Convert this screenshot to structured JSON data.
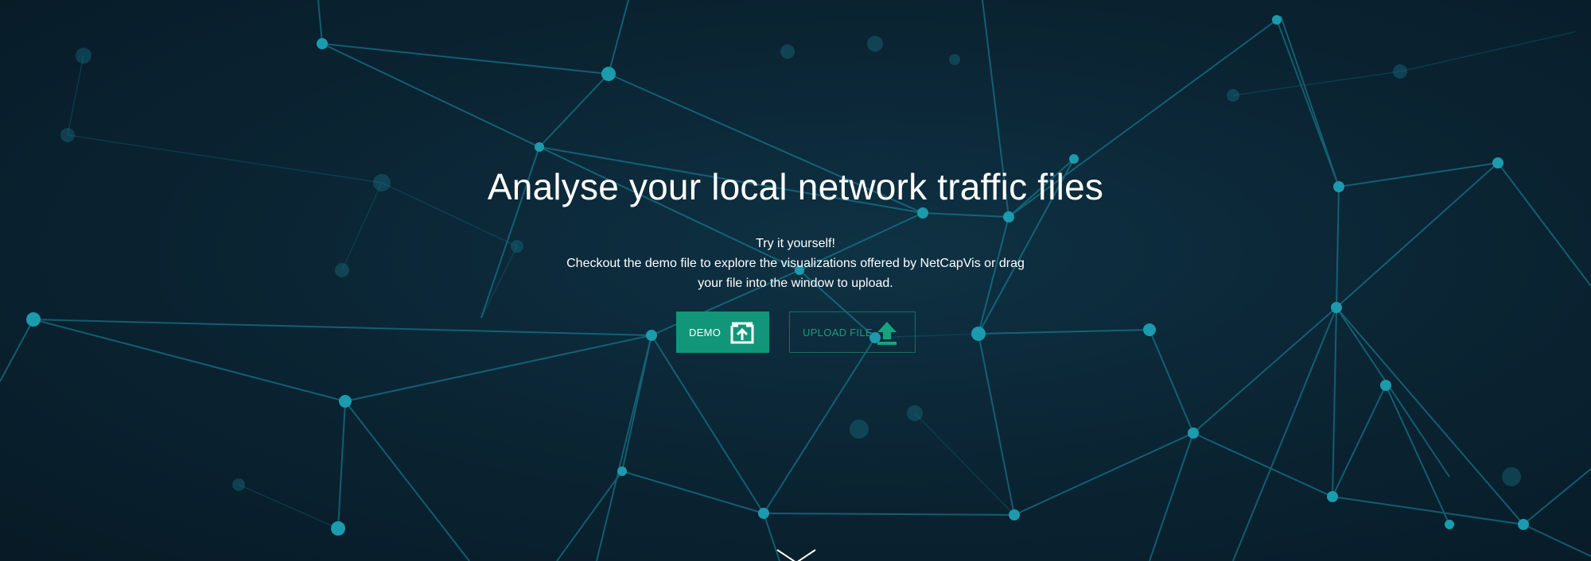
{
  "hero": {
    "title": "Analyse your local network traffic files",
    "subtitle_line1": "Try it yourself!",
    "subtitle_line2": "Checkout the demo file to explore the visualizations offered by NetCapVis or drag",
    "subtitle_line3": "your file into the window to upload."
  },
  "buttons": {
    "demo_label": "DEMO",
    "demo_icon": "open-external-icon",
    "upload_label": "UPLOAD FILE",
    "upload_icon": "upload-arrow-icon"
  },
  "scroll": {
    "icon": "chevron-down-icon"
  },
  "colors": {
    "background": "#0a2130",
    "accent": "#11967a",
    "network": "#1a8fa3"
  }
}
